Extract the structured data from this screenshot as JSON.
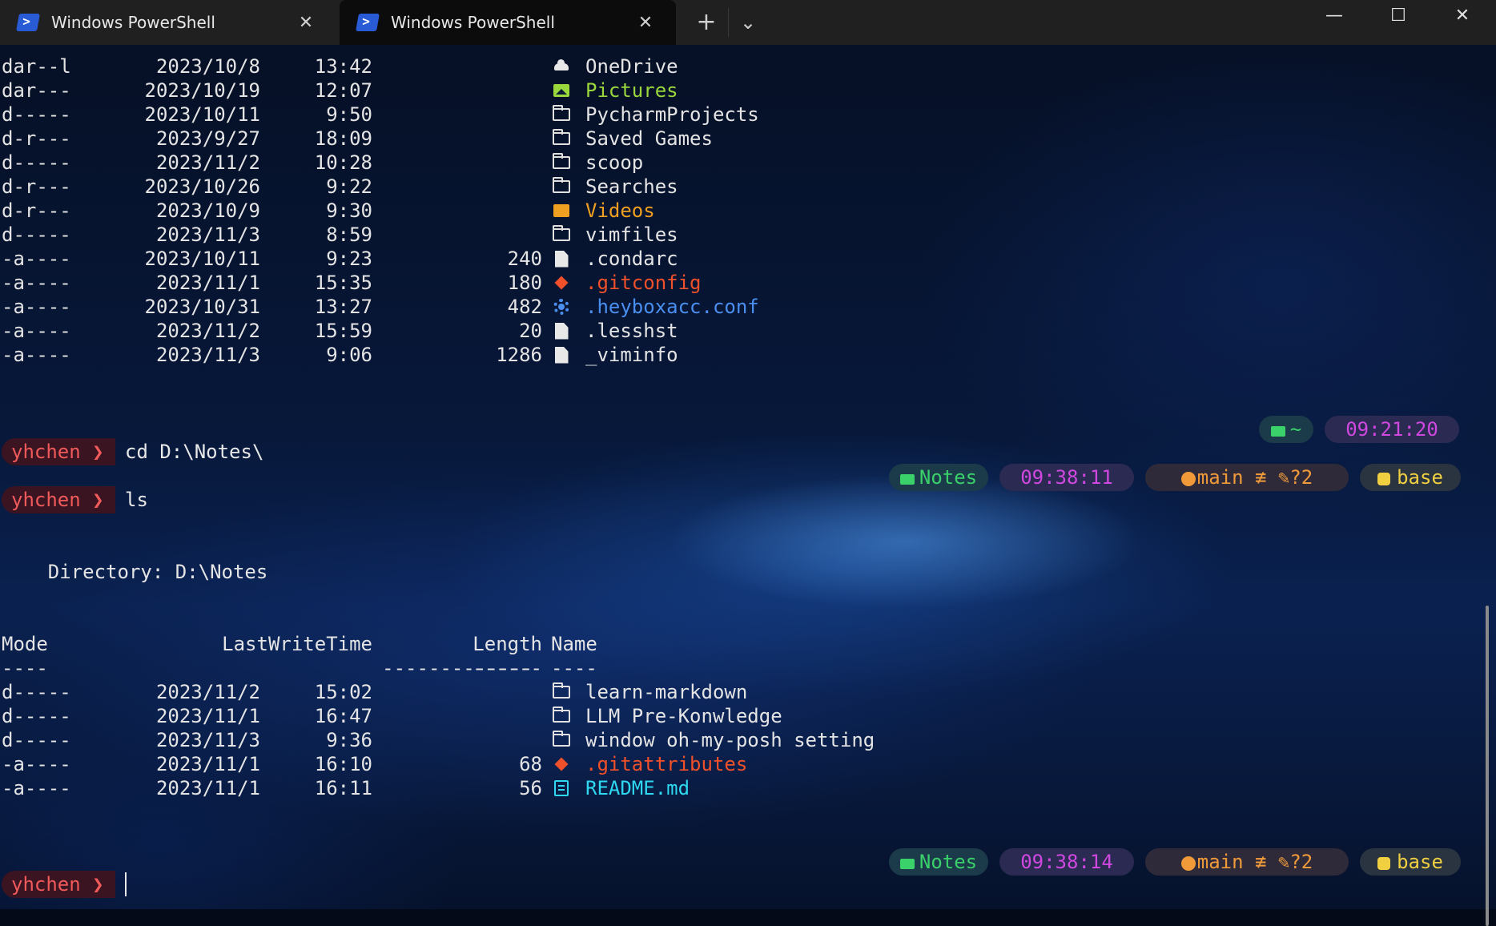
{
  "tabs": [
    {
      "title": "Windows PowerShell",
      "active": false
    },
    {
      "title": "Windows PowerShell",
      "active": true
    }
  ],
  "tab_controls": {
    "new_tab": "+",
    "dropdown": "⌄",
    "close": "✕"
  },
  "window_controls": {
    "minimize": "—",
    "maximize": "☐",
    "close": "✕"
  },
  "listing1": [
    {
      "mode": "dar--l",
      "date": "2023/10/8",
      "time": "13:42",
      "length": "",
      "name": "OneDrive",
      "icon": "cloud-icon",
      "color": "#e4e4e4"
    },
    {
      "mode": "dar---",
      "date": "2023/10/19",
      "time": "12:07",
      "length": "",
      "name": "Pictures",
      "icon": "pictures-icon",
      "color": "#9ad73c"
    },
    {
      "mode": "d-----",
      "date": "2023/10/11",
      "time": "9:50",
      "length": "",
      "name": "PycharmProjects",
      "icon": "folder-icon",
      "color": "#e4e4e4"
    },
    {
      "mode": "d-r---",
      "date": "2023/9/27",
      "time": "18:09",
      "length": "",
      "name": "Saved Games",
      "icon": "folder-icon",
      "color": "#e4e4e4"
    },
    {
      "mode": "d-----",
      "date": "2023/11/2",
      "time": "10:28",
      "length": "",
      "name": "scoop",
      "icon": "folder-icon",
      "color": "#e4e4e4"
    },
    {
      "mode": "d-r---",
      "date": "2023/10/26",
      "time": "9:22",
      "length": "",
      "name": "Searches",
      "icon": "folder-icon",
      "color": "#e4e4e4"
    },
    {
      "mode": "d-r---",
      "date": "2023/10/9",
      "time": "9:30",
      "length": "",
      "name": "Videos",
      "icon": "videos-icon",
      "color": "#f0a020"
    },
    {
      "mode": "d-----",
      "date": "2023/11/3",
      "time": "8:59",
      "length": "",
      "name": "vimfiles",
      "icon": "folder-icon",
      "color": "#e4e4e4"
    },
    {
      "mode": "-a----",
      "date": "2023/10/11",
      "time": "9:23",
      "length": "240",
      "name": ".condarc",
      "icon": "file-icon",
      "color": "#e4e4e4"
    },
    {
      "mode": "-a----",
      "date": "2023/11/1",
      "time": "15:35",
      "length": "180",
      "name": ".gitconfig",
      "icon": "git-icon",
      "color": "#f0502a"
    },
    {
      "mode": "-a----",
      "date": "2023/10/31",
      "time": "13:27",
      "length": "482",
      "name": ".heyboxacc.conf",
      "icon": "gear-icon",
      "color": "#4a8ff0"
    },
    {
      "mode": "-a----",
      "date": "2023/11/2",
      "time": "15:59",
      "length": "20",
      "name": ".lesshst",
      "icon": "file-icon",
      "color": "#e4e4e4"
    },
    {
      "mode": "-a----",
      "date": "2023/11/3",
      "time": "9:06",
      "length": "1286",
      "name": "_viminfo",
      "icon": "file-icon",
      "color": "#e4e4e4"
    }
  ],
  "segments_top": {
    "dir": "~",
    "time": "09:21:20"
  },
  "prompts": [
    {
      "user": "yhchen ❯",
      "command": "cd D:\\Notes\\"
    },
    {
      "user": "yhchen ❯",
      "command": "ls"
    },
    {
      "user": "yhchen ❯",
      "command": ""
    }
  ],
  "segments_1": {
    "dir": "Notes",
    "time": "09:38:11",
    "git": "main ≢ ✎?2",
    "env": "base"
  },
  "segments_2": {
    "dir": "Notes",
    "time": "09:38:14",
    "git": "main ≢ ✎?2",
    "env": "base"
  },
  "directory_line": "    Directory: D:\\Notes",
  "headers": {
    "mode": "Mode",
    "lastwrite": "LastWriteTime",
    "length": "Length",
    "name": "Name"
  },
  "underlines": {
    "mode": "----",
    "lastwrite": "-------------",
    "length": "------",
    "name": "----"
  },
  "listing2": [
    {
      "mode": "d-----",
      "date": "2023/11/2",
      "time": "15:02",
      "length": "",
      "name": "learn-markdown",
      "icon": "folder-icon",
      "color": "#e4e4e4"
    },
    {
      "mode": "d-----",
      "date": "2023/11/1",
      "time": "16:47",
      "length": "",
      "name": "LLM Pre-Konwledge",
      "icon": "folder-icon",
      "color": "#e4e4e4"
    },
    {
      "mode": "d-----",
      "date": "2023/11/3",
      "time": "9:36",
      "length": "",
      "name": "window oh-my-posh setting",
      "icon": "folder-icon",
      "color": "#e4e4e4"
    },
    {
      "mode": "-a----",
      "date": "2023/11/1",
      "time": "16:10",
      "length": "68",
      "name": ".gitattributes",
      "icon": "git-icon",
      "color": "#f0502a"
    },
    {
      "mode": "-a----",
      "date": "2023/11/1",
      "time": "16:11",
      "length": "56",
      "name": "README.md",
      "icon": "markdown-icon",
      "color": "#2ed8f0"
    }
  ]
}
